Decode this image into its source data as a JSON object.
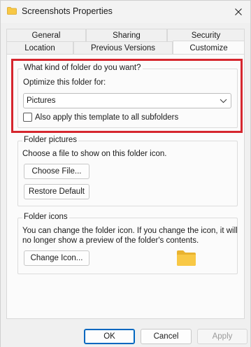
{
  "window": {
    "title": "Screenshots Properties",
    "close_icon": "close-icon"
  },
  "tabs": {
    "row_back": [
      {
        "label": "General"
      },
      {
        "label": "Sharing"
      },
      {
        "label": "Security"
      }
    ],
    "row_front": [
      {
        "label": "Location"
      },
      {
        "label": "Previous Versions"
      },
      {
        "label": "Customize",
        "selected": true
      }
    ]
  },
  "folder_type": {
    "legend": "What kind of folder do you want?",
    "optimize_label": "Optimize this folder for:",
    "selected_value": "Pictures",
    "apply_subfolders_label": "Also apply this template to all subfolders",
    "apply_subfolders_checked": false
  },
  "folder_pictures": {
    "legend": "Folder pictures",
    "description": "Choose a file to show on this folder icon.",
    "choose_file_label": "Choose File...",
    "restore_default_label": "Restore Default"
  },
  "folder_icons": {
    "legend": "Folder icons",
    "description_line1": "You can change the folder icon. If you change the icon, it will",
    "description_line2": "no longer show a preview of the folder's contents.",
    "change_icon_label": "Change Icon..."
  },
  "footer": {
    "ok_label": "OK",
    "cancel_label": "Cancel",
    "apply_label": "Apply"
  },
  "colors": {
    "highlight_box": "#d6262e",
    "folder_yellow": "#f8c845",
    "default_button_border": "#0067c0"
  }
}
